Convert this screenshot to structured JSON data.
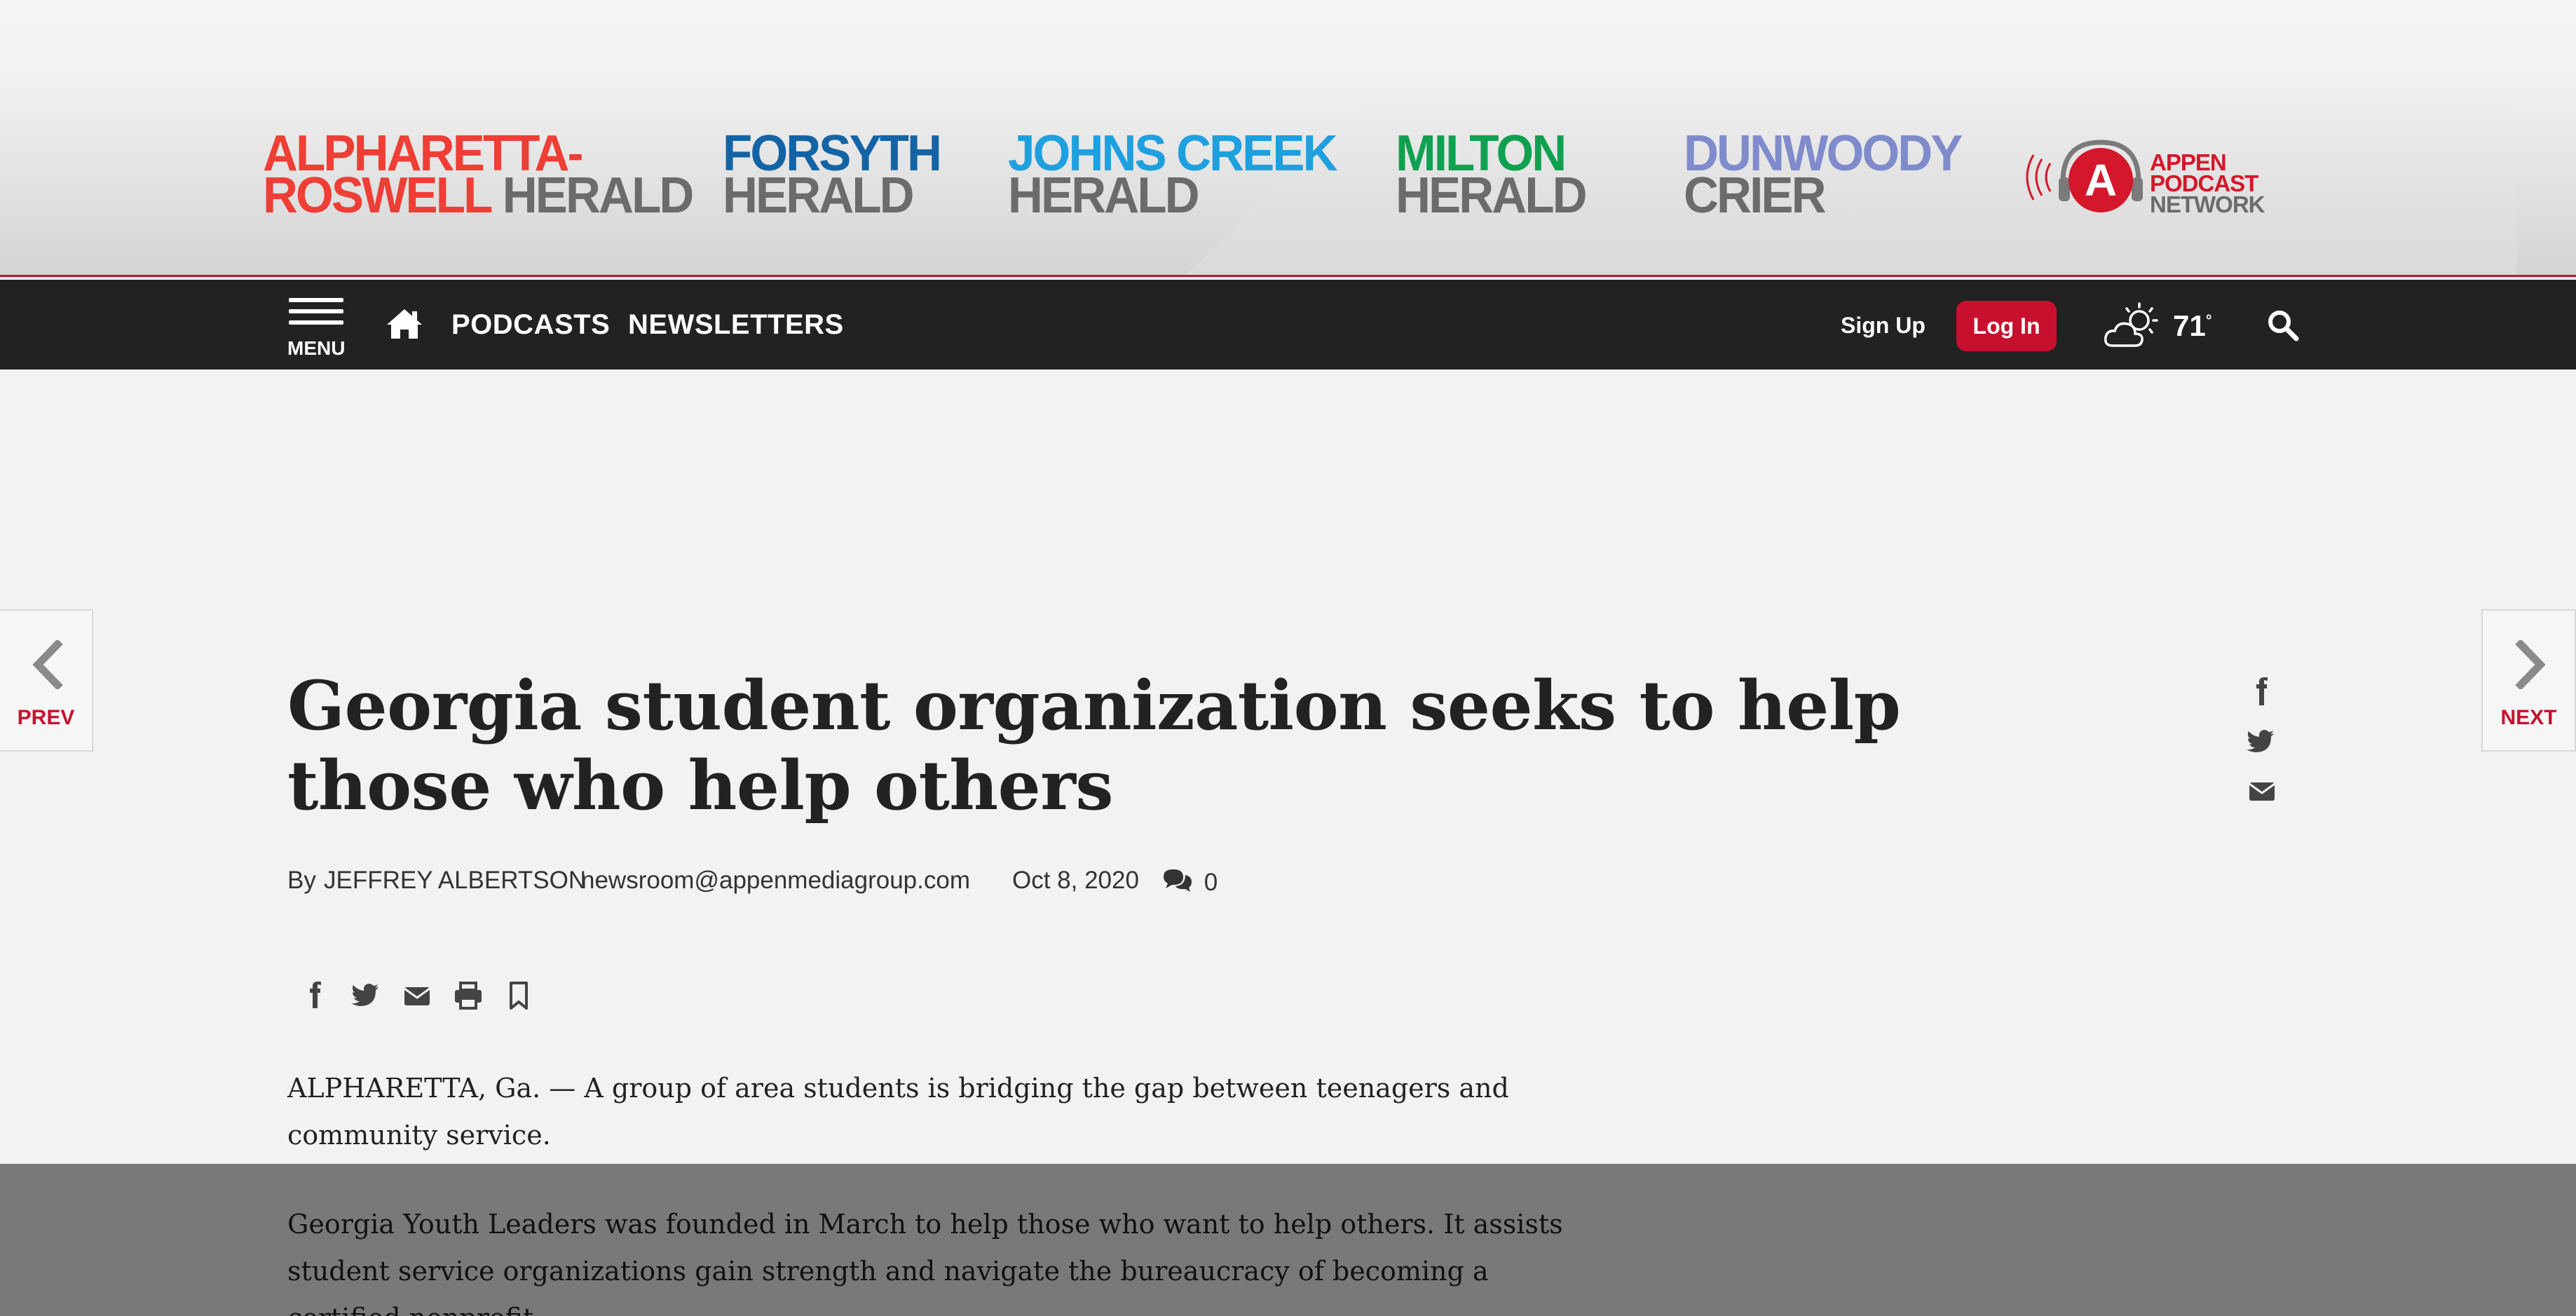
{
  "banner": {
    "publications": [
      {
        "line1": "ALPHARETTA-",
        "line2a": "ROSWELL",
        "line2b": "HERALD",
        "color": "#ee3e35"
      },
      {
        "line1": "FORSYTH",
        "line2b": "HERALD",
        "color": "#1464a5"
      },
      {
        "line1": "JOHNS CREEK",
        "line2b": "HERALD",
        "color": "#1ea0df"
      },
      {
        "line1": "MILTON",
        "line2b": "HERALD",
        "color": "#0fa050"
      },
      {
        "line1": "DUNWOODY",
        "line2b": "CRIER",
        "color": "#7f8bcb"
      }
    ],
    "podcast": {
      "mark": "A",
      "line1": "APPEN",
      "line2": "PODCAST",
      "line3": "NETWORK",
      "color": "#d4172a"
    },
    "accent_color": "#c8102e"
  },
  "nav": {
    "menu_label": "MENU",
    "links": [
      "PODCASTS",
      "NEWSLETTERS"
    ],
    "sign_up": "Sign Up",
    "log_in": "Log In",
    "temperature": "71",
    "degree": "°",
    "icons": {
      "menu": "hamburger-icon",
      "home": "home-icon",
      "weather": "partly-cloudy-icon",
      "search": "search-icon"
    }
  },
  "pager": {
    "prev": "PREV",
    "next": "NEXT"
  },
  "article": {
    "headline": "Georgia student organization seeks to help those who help others",
    "byline_prefix": "By",
    "author": "JEFFREY ALBERTSON",
    "email": "newsroom@appenmediagroup.com",
    "date": "Oct 8, 2020",
    "comment_count": "0",
    "paragraphs": [
      "ALPHARETTA, Ga. — A group of area students is bridging the gap between teenagers and community service.",
      "Georgia Youth Leaders was founded in March to help those who want to help others. It assists student service organizations gain strength and navigate the bureaucracy of becoming a certified nonprofit."
    ]
  }
}
